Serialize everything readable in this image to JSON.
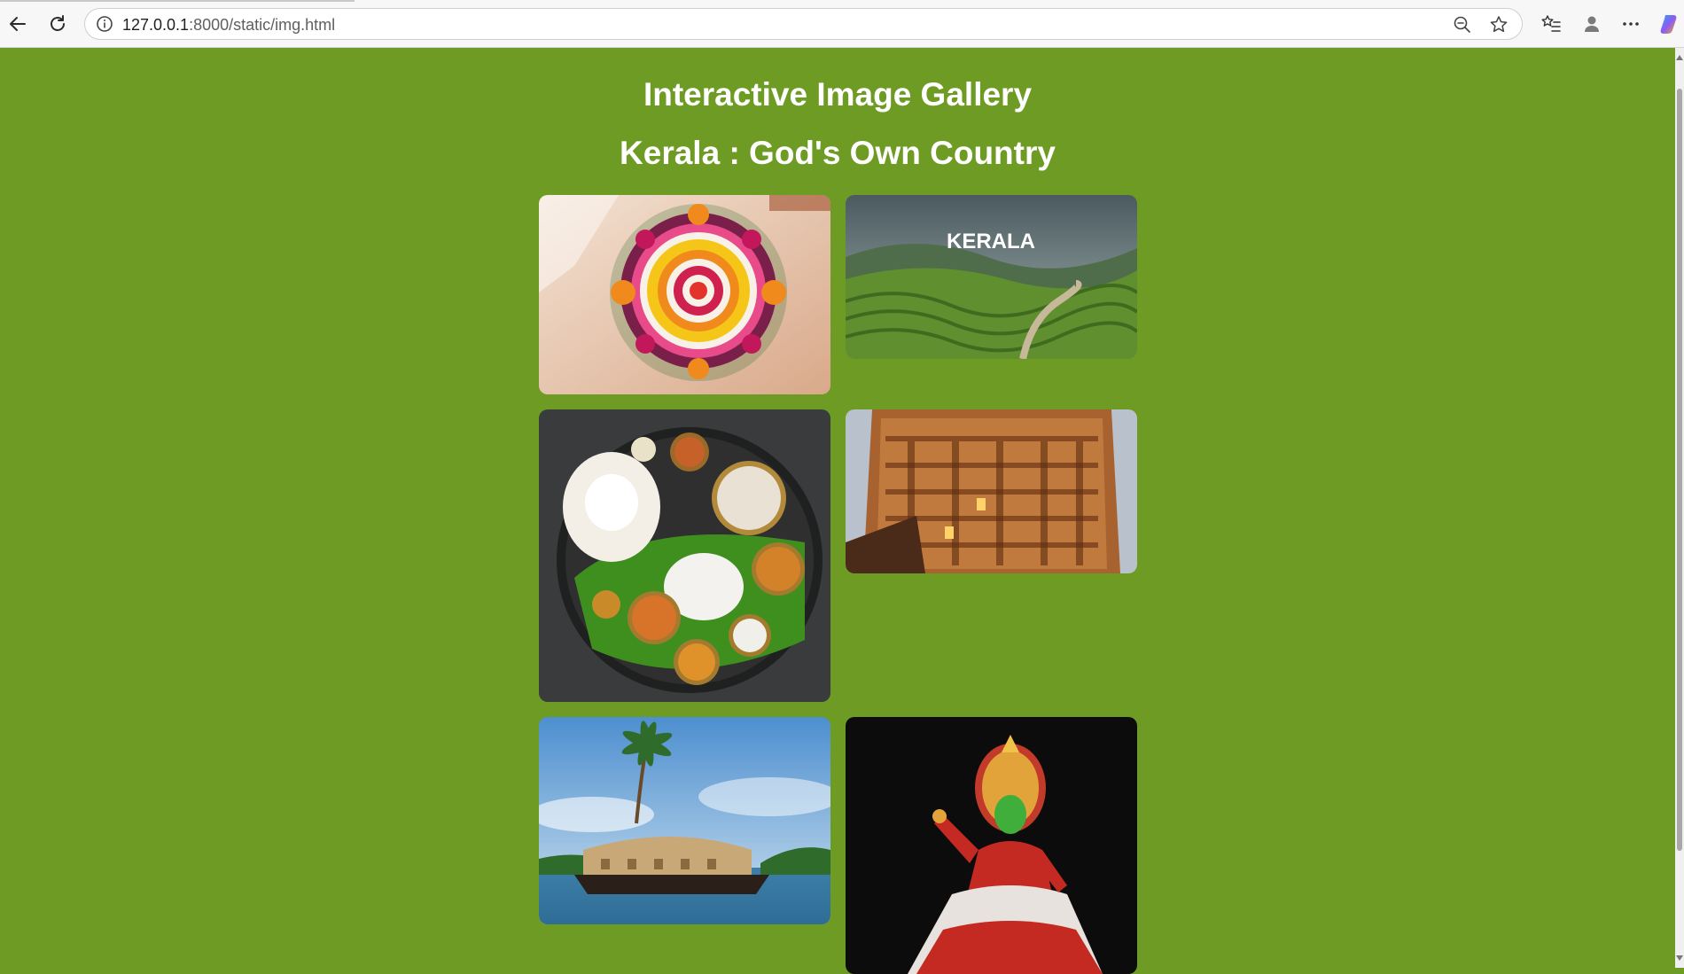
{
  "browser": {
    "url_host": "127.0.0.1",
    "url_port": ":8000",
    "url_path": "/static/img.html",
    "icons": [
      "back-icon",
      "reload-icon",
      "site-info-icon",
      "zoom-out-icon",
      "favorite-star-icon",
      "favorites-list-icon",
      "profile-icon",
      "more-icon",
      "copilot-icon"
    ]
  },
  "page": {
    "title": "Interactive Image Gallery",
    "subtitle": "Kerala : God's Own Country",
    "background": "#6e9b23",
    "heading_color": "#ffffff"
  },
  "gallery": {
    "images": [
      {
        "subject": "flower-rangoli"
      },
      {
        "subject": "tea-plantation",
        "caption": "KERALA"
      },
      {
        "subject": "kerala-meal"
      },
      {
        "subject": "temple-gopuram"
      },
      {
        "subject": "houseboat"
      },
      {
        "subject": "kathakali-dancer"
      }
    ]
  }
}
